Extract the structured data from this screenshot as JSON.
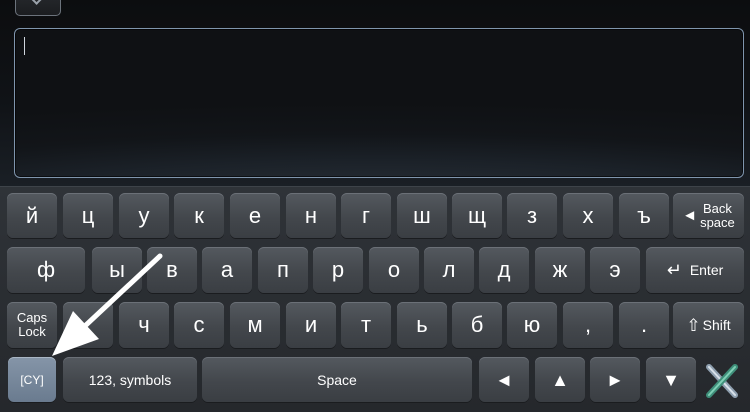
{
  "keyboard": {
    "row1": [
      "й",
      "ц",
      "у",
      "к",
      "е",
      "н",
      "г",
      "ш",
      "щ",
      "з",
      "х",
      "ъ"
    ],
    "row2": [
      "ф",
      "ы",
      "в",
      "а",
      "п",
      "р",
      "о",
      "л",
      "д",
      "ж",
      "э"
    ],
    "row3": [
      "ч",
      "с",
      "м",
      "и",
      "т",
      "ь",
      "б",
      "ю",
      ",",
      "."
    ],
    "backspace": {
      "line1": "Back",
      "line2": "space",
      "icon": "◄"
    },
    "enter": {
      "label": "Enter",
      "icon": "↵"
    },
    "caps_lock": {
      "line1": "Caps",
      "line2": "Lock"
    },
    "shift": {
      "label": "Shift",
      "icon": "⇧"
    },
    "lang": "[CY]",
    "symbols": "123, symbols",
    "space": "Space",
    "arrows": {
      "left": "◄",
      "up": "▲",
      "right": "►",
      "down": "▼"
    }
  },
  "colors": {
    "key_top": "#54595f",
    "key_bottom": "#3a3e43",
    "lang_key": "#7a8a9e",
    "text_area_border": "#7f95ad"
  }
}
